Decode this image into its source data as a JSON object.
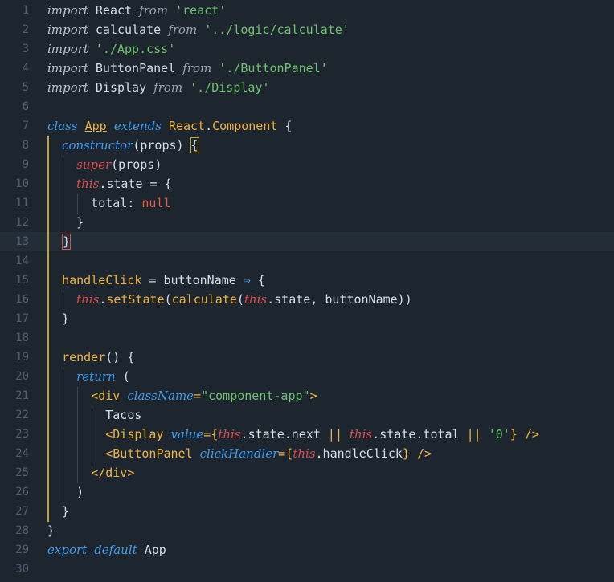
{
  "editor": {
    "lines": [
      {
        "n": "1",
        "tokens": [
          [
            "imp",
            "import"
          ],
          [
            "pl",
            " React "
          ],
          [
            "from",
            "from"
          ],
          [
            "pl",
            " "
          ],
          [
            "str",
            "'react'"
          ]
        ]
      },
      {
        "n": "2",
        "tokens": [
          [
            "imp",
            "import"
          ],
          [
            "pl",
            " calculate "
          ],
          [
            "from",
            "from"
          ],
          [
            "pl",
            " "
          ],
          [
            "str",
            "'../logic/calculate'"
          ]
        ]
      },
      {
        "n": "3",
        "tokens": [
          [
            "imp",
            "import"
          ],
          [
            "pl",
            " "
          ],
          [
            "str",
            "'./App.css'"
          ]
        ]
      },
      {
        "n": "4",
        "tokens": [
          [
            "imp",
            "import"
          ],
          [
            "pl",
            " ButtonPanel "
          ],
          [
            "from",
            "from"
          ],
          [
            "pl",
            " "
          ],
          [
            "str",
            "'./ButtonPanel'"
          ]
        ]
      },
      {
        "n": "5",
        "tokens": [
          [
            "imp",
            "import"
          ],
          [
            "pl",
            " Display "
          ],
          [
            "from",
            "from"
          ],
          [
            "pl",
            " "
          ],
          [
            "str",
            "'./Display'"
          ]
        ]
      },
      {
        "n": "6",
        "tokens": []
      },
      {
        "n": "7",
        "tokens": [
          [
            "kw",
            "class"
          ],
          [
            "pl",
            " "
          ],
          [
            "cls u",
            "App"
          ],
          [
            "pl",
            " "
          ],
          [
            "kw",
            "extends"
          ],
          [
            "pl",
            " "
          ],
          [
            "cls",
            "React"
          ],
          [
            "pl",
            "."
          ],
          [
            "cls",
            "Component"
          ],
          [
            "pl",
            " {"
          ]
        ]
      },
      {
        "n": "8",
        "tokens": [
          [
            "pl",
            "  "
          ],
          [
            "ctor",
            "constructor"
          ],
          [
            "pl",
            "(props) "
          ],
          [
            "bracket-hl",
            "{"
          ]
        ]
      },
      {
        "n": "9",
        "tokens": [
          [
            "pl",
            "    "
          ],
          [
            "super",
            "super"
          ],
          [
            "pl",
            "(props)"
          ]
        ]
      },
      {
        "n": "10",
        "tokens": [
          [
            "pl",
            "    "
          ],
          [
            "this",
            "this"
          ],
          [
            "pl",
            ".state = {"
          ]
        ]
      },
      {
        "n": "11",
        "tokens": [
          [
            "pl",
            "      total: "
          ],
          [
            "nul",
            "null"
          ]
        ]
      },
      {
        "n": "12",
        "tokens": [
          [
            "pl",
            "    }"
          ]
        ]
      },
      {
        "n": "13",
        "tokens": [
          [
            "pl",
            "  "
          ],
          [
            "bracket-red",
            "}"
          ]
        ]
      },
      {
        "n": "14",
        "tokens": []
      },
      {
        "n": "15",
        "tokens": [
          [
            "pl",
            "  "
          ],
          [
            "fn",
            "handleClick"
          ],
          [
            "pl",
            " = buttonName "
          ],
          [
            "arrow",
            "⇒"
          ],
          [
            "pl",
            " {"
          ]
        ]
      },
      {
        "n": "16",
        "tokens": [
          [
            "pl",
            "    "
          ],
          [
            "this",
            "this"
          ],
          [
            "pl",
            "."
          ],
          [
            "fn",
            "setState"
          ],
          [
            "pl",
            "("
          ],
          [
            "fn",
            "calculate"
          ],
          [
            "pl",
            "("
          ],
          [
            "this",
            "this"
          ],
          [
            "pl",
            ".state, buttonName))"
          ]
        ]
      },
      {
        "n": "17",
        "tokens": [
          [
            "pl",
            "  }"
          ]
        ]
      },
      {
        "n": "18",
        "tokens": []
      },
      {
        "n": "19",
        "tokens": [
          [
            "pl",
            "  "
          ],
          [
            "fn",
            "render"
          ],
          [
            "pl",
            "() {"
          ]
        ]
      },
      {
        "n": "20",
        "tokens": [
          [
            "pl",
            "    "
          ],
          [
            "kw",
            "return"
          ],
          [
            "pl",
            " ("
          ]
        ]
      },
      {
        "n": "21",
        "tokens": [
          [
            "pl",
            "      "
          ],
          [
            "op",
            "<"
          ],
          [
            "tag",
            "div"
          ],
          [
            "pl",
            " "
          ],
          [
            "attr",
            "className"
          ],
          [
            "op",
            "="
          ],
          [
            "str",
            "\"component-app\""
          ],
          [
            "op",
            ">"
          ]
        ]
      },
      {
        "n": "22",
        "tokens": [
          [
            "pl",
            "        Tacos"
          ]
        ]
      },
      {
        "n": "23",
        "tokens": [
          [
            "pl",
            "        "
          ],
          [
            "op",
            "<"
          ],
          [
            "tag",
            "Display"
          ],
          [
            "pl",
            " "
          ],
          [
            "attr",
            "value"
          ],
          [
            "op",
            "={"
          ],
          [
            "this",
            "this"
          ],
          [
            "pl",
            ".state.next "
          ],
          [
            "op",
            "||"
          ],
          [
            "pl",
            " "
          ],
          [
            "this",
            "this"
          ],
          [
            "pl",
            ".state.total "
          ],
          [
            "op",
            "||"
          ],
          [
            "pl",
            " "
          ],
          [
            "str",
            "'0'"
          ],
          [
            "op",
            "}"
          ],
          [
            "pl",
            " "
          ],
          [
            "op",
            "/>"
          ]
        ]
      },
      {
        "n": "24",
        "tokens": [
          [
            "pl",
            "        "
          ],
          [
            "op",
            "<"
          ],
          [
            "tag",
            "ButtonPanel"
          ],
          [
            "pl",
            " "
          ],
          [
            "attr",
            "clickHandler"
          ],
          [
            "op",
            "={"
          ],
          [
            "this",
            "this"
          ],
          [
            "pl",
            ".handleClick"
          ],
          [
            "op",
            "}"
          ],
          [
            "pl",
            " "
          ],
          [
            "op",
            "/>"
          ]
        ]
      },
      {
        "n": "25",
        "tokens": [
          [
            "pl",
            "      "
          ],
          [
            "op",
            "</"
          ],
          [
            "tag",
            "div"
          ],
          [
            "op",
            ">"
          ]
        ]
      },
      {
        "n": "26",
        "tokens": [
          [
            "pl",
            "    )"
          ]
        ]
      },
      {
        "n": "27",
        "tokens": [
          [
            "pl",
            "  }"
          ]
        ]
      },
      {
        "n": "28",
        "tokens": [
          [
            "pl",
            "}"
          ]
        ]
      },
      {
        "n": "29",
        "tokens": [
          [
            "kw",
            "export"
          ],
          [
            "pl",
            " "
          ],
          [
            "kw",
            "default"
          ],
          [
            "pl",
            " App"
          ]
        ]
      },
      {
        "n": "30",
        "tokens": []
      }
    ],
    "active_line": "13"
  }
}
